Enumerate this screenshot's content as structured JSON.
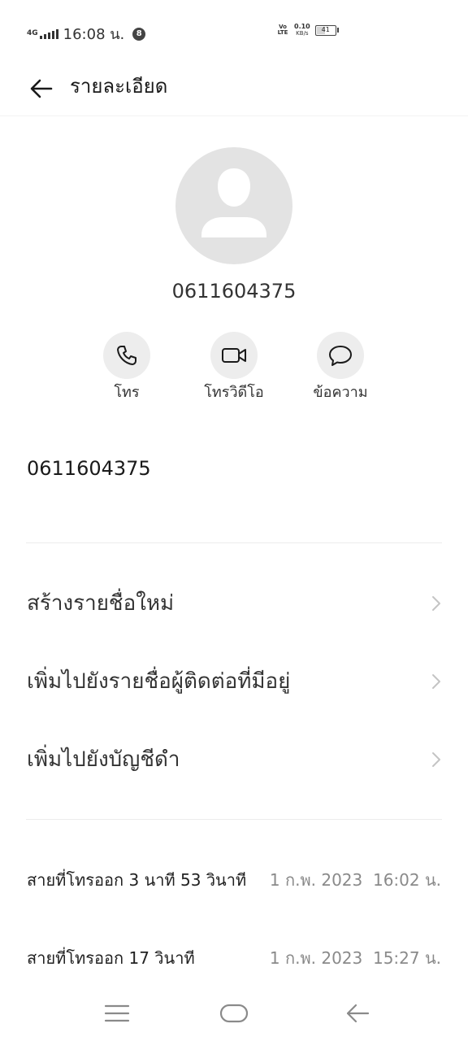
{
  "status_bar": {
    "network": "4G",
    "time": "16:08 น.",
    "notification_count": "8",
    "volte": "Vo LTE",
    "speed_value": "0.10",
    "speed_unit": "KB/s",
    "battery_level": "41",
    "battery_fraction": 0.41
  },
  "app_bar": {
    "title": "รายละเอียด",
    "back_icon": "arrow-left-icon"
  },
  "contact": {
    "avatar_icon": "person-icon",
    "number": "0611604375"
  },
  "actions": [
    {
      "label": "โทร",
      "icon": "phone-icon"
    },
    {
      "label": "โทรวิดีโอ",
      "icon": "video-camera-icon"
    },
    {
      "label": "ข้อความ",
      "icon": "chat-bubble-icon"
    }
  ],
  "phone_entry": "0611604375",
  "menu": [
    {
      "label": "สร้างรายชื่อใหม่"
    },
    {
      "label": "เพิ่มไปยังรายชื่อผู้ติดต่อที่มีอยู่"
    },
    {
      "label": "เพิ่มไปยังบัญชีดำ"
    }
  ],
  "call_log": [
    {
      "type": "สายที่โทรออก 3 นาที 53 วินาที",
      "datetime": "1 ก.พ. 2023  16:02 น."
    },
    {
      "type": "สายที่โทรออก 17 วินาที",
      "datetime": "1 ก.พ. 2023  15:27 น."
    }
  ],
  "nav_bar": {
    "menu_icon": "menu-icon",
    "home_icon": "home-icon",
    "back_icon": "back-icon"
  },
  "colors": {
    "background": "#ffffff",
    "avatar_bg": "#e3e3e3",
    "action_bg": "#ededed",
    "secondary_text": "#8a8a8a"
  }
}
